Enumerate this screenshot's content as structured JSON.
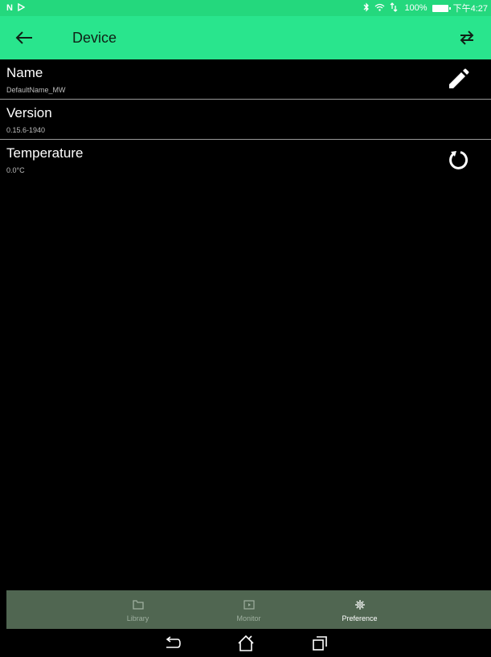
{
  "status_bar": {
    "left_icons": [
      "n-icon",
      "play-store-icon"
    ],
    "right_icons": [
      "bluetooth-icon",
      "wifi-icon",
      "data-icon"
    ],
    "battery": "100%",
    "time": "下午4:27"
  },
  "app_bar": {
    "title": "Device",
    "back_icon": "arrow-back-icon",
    "swap_icon": "swap-icon",
    "background": "#29e58d"
  },
  "device_info": {
    "items": [
      {
        "label": "Name",
        "value": "DefaultName_MW",
        "action_icon": "edit-pencil-icon"
      },
      {
        "label": "Version",
        "value": "0.15.6-1940"
      },
      {
        "label": "Temperature",
        "value": "0.0°C",
        "action_icon": "refresh-icon"
      }
    ]
  },
  "bottom_nav": {
    "items": [
      {
        "label": "Library",
        "icon": "folder-icon",
        "active": false
      },
      {
        "label": "Monitor",
        "icon": "play-screen-icon",
        "active": false
      },
      {
        "label": "Preference",
        "icon": "gear-icon",
        "active": true
      }
    ]
  },
  "system_nav": [
    "back-icon",
    "home-icon",
    "recents-icon"
  ]
}
